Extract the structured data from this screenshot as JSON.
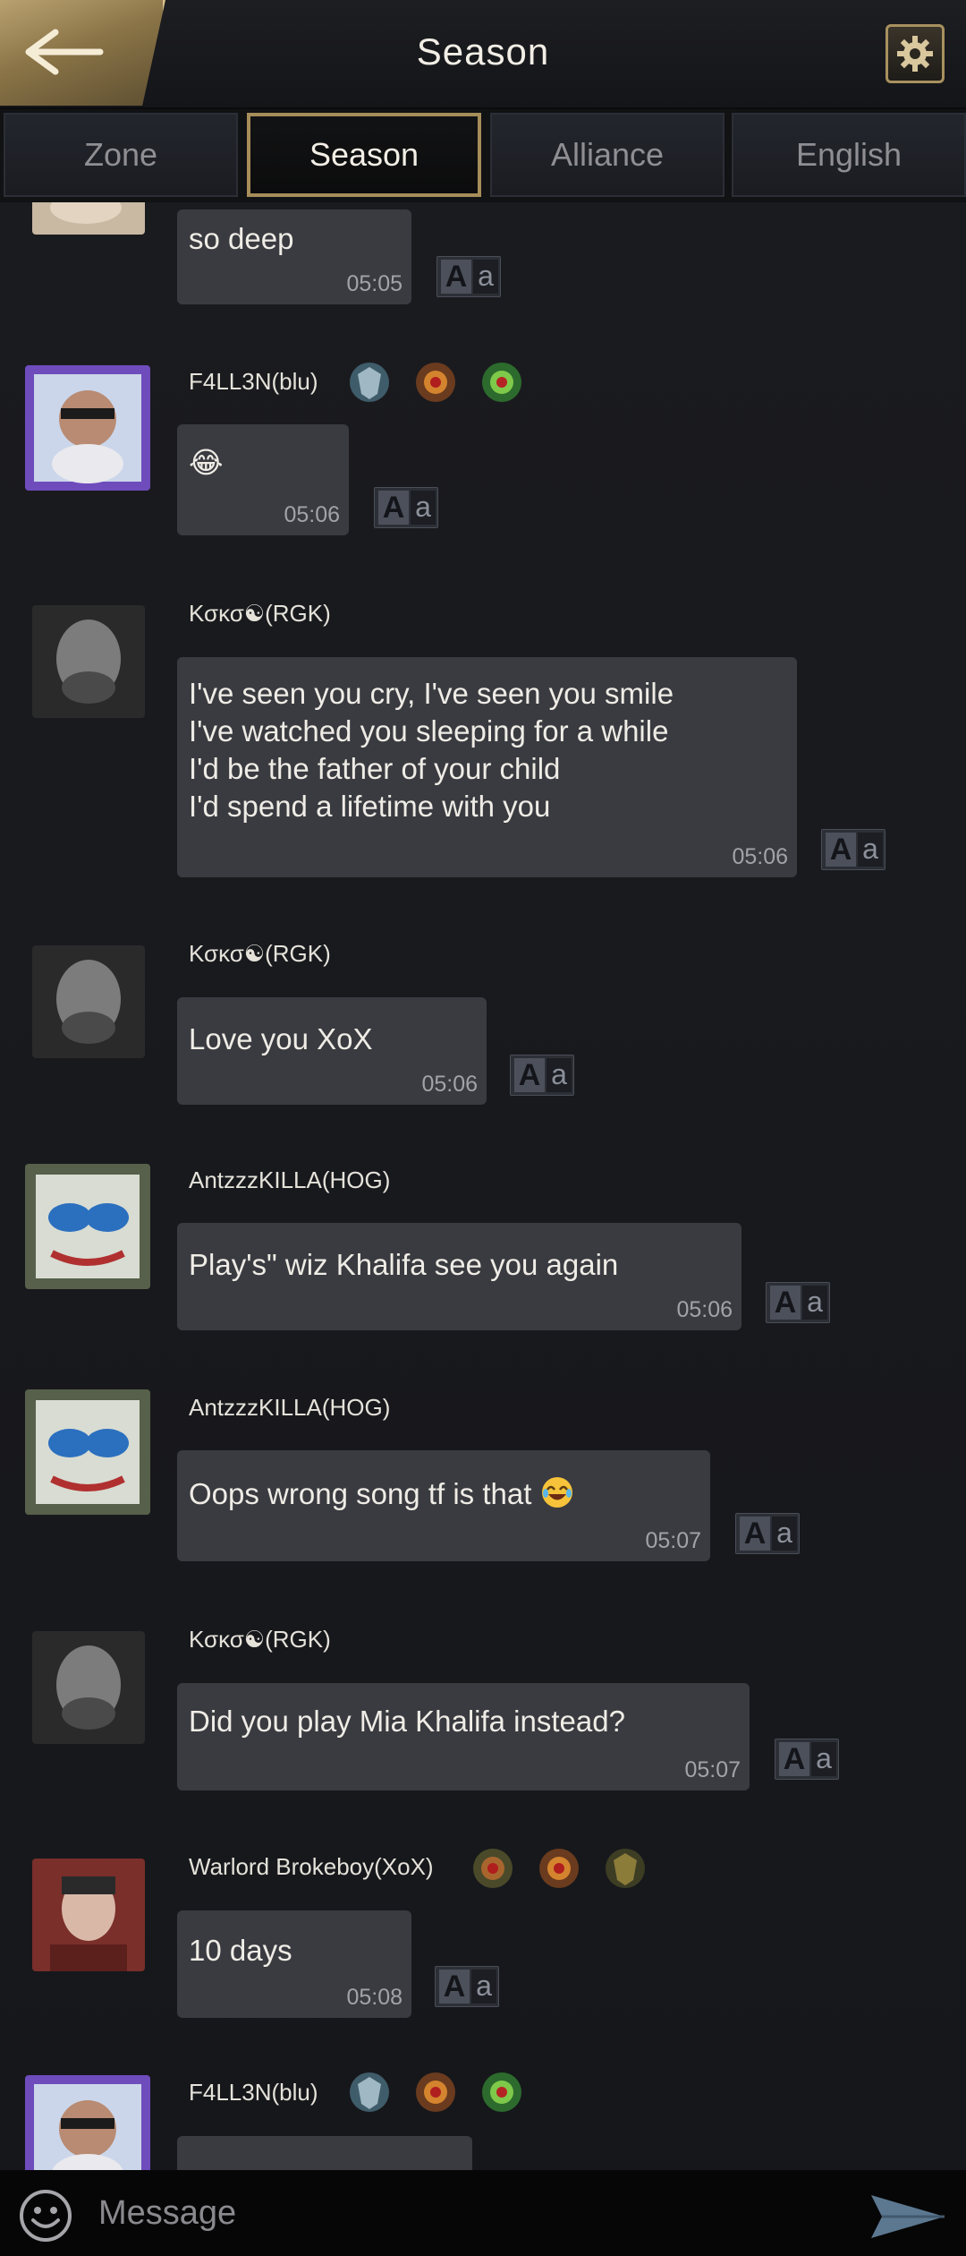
{
  "header": {
    "title": "Season"
  },
  "tabs": [
    {
      "label": "Zone",
      "active": false
    },
    {
      "label": "Season",
      "active": true
    },
    {
      "label": "Alliance",
      "active": false
    },
    {
      "label": "English",
      "active": false
    }
  ],
  "messages": [
    {
      "user": "",
      "text": "so deep",
      "time": "05:05"
    },
    {
      "user": "F4LL3N(blu)",
      "text": "😂",
      "time": "05:06"
    },
    {
      "user": "Κσκσ☯(RGK)",
      "text": "I've seen you cry, I've seen you smile\nI've watched you sleeping for a while\nI'd be the father of your child\nI'd spend a lifetime with you",
      "time": "05:06"
    },
    {
      "user": "Κσκσ☯(RGK)",
      "text": "Love you XoX",
      "time": "05:06"
    },
    {
      "user": "AntzzzKILLA(HOG)",
      "text": "Play's\" wiz Khalifa see you again",
      "time": "05:06"
    },
    {
      "user": "AntzzzKILLA(HOG)",
      "text": "Oops wrong song tf is that",
      "time": "05:07"
    },
    {
      "user": "Κσκσ☯(RGK)",
      "text": "Did you play Mia Khalifa instead?",
      "time": "05:07"
    },
    {
      "user": "Warlord Brokeboy(XoX)",
      "text": "10 days",
      "time": "05:08"
    },
    {
      "user": "F4LL3N(blu)",
      "text": "",
      "time": ""
    }
  ],
  "translate": {
    "big": "A",
    "small": "a"
  },
  "input": {
    "placeholder": "Message",
    "value": ""
  },
  "colors": {
    "accent_gold": "#a68d5a",
    "bubble": "#3a3b40",
    "background": "#16171b"
  }
}
